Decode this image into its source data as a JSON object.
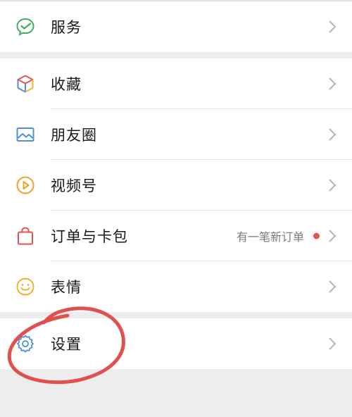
{
  "services": {
    "label": "服务",
    "icon": "wechat-pay-icon"
  },
  "menu": [
    {
      "key": "favorites",
      "label": "收藏",
      "icon": "cube-icon"
    },
    {
      "key": "moments",
      "label": "朋友圈",
      "icon": "image-icon"
    },
    {
      "key": "channels",
      "label": "视频号",
      "icon": "play-icon"
    },
    {
      "key": "orders",
      "label": "订单与卡包",
      "icon": "bag-icon",
      "note": "有一笔新订单"
    },
    {
      "key": "stickers",
      "label": "表情",
      "icon": "smiley-icon"
    }
  ],
  "settings": {
    "label": "设置",
    "icon": "gear-icon"
  },
  "colors": {
    "background": "#ededed",
    "row": "#ffffff",
    "badge_dot": "#e8534f",
    "annotation": "#e0504d"
  }
}
